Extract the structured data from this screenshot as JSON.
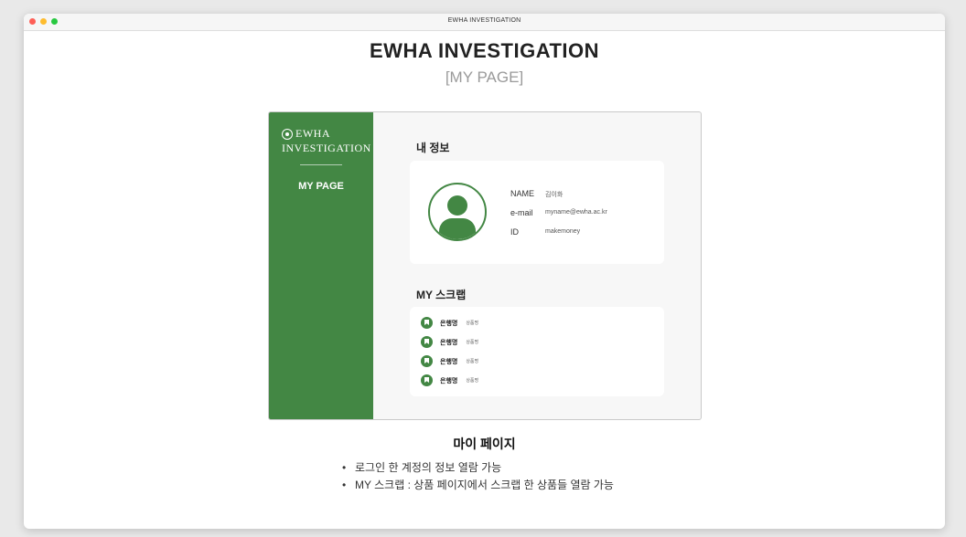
{
  "window": {
    "title": "EWHA INVESTIGATION"
  },
  "header": {
    "title": "EWHA INVESTIGATION",
    "subtitle": "[MY PAGE]"
  },
  "sidebar": {
    "logo_line1": "EWHA",
    "logo_line2": "INVESTIGATION",
    "menu_item": "MY PAGE",
    "color": "#438744"
  },
  "profile": {
    "section_title": "내 정보",
    "fields": [
      {
        "label": "NAME",
        "value": "김이화"
      },
      {
        "label": "e-mail",
        "value": "myname@ewha.ac.kr"
      },
      {
        "label": "ID",
        "value": "makemoney"
      }
    ]
  },
  "scrap": {
    "section_title": "MY 스크랩",
    "items": [
      {
        "bank": "은행명",
        "product": "상품명"
      },
      {
        "bank": "은행명",
        "product": "상품명"
      },
      {
        "bank": "은행명",
        "product": "상품명"
      },
      {
        "bank": "은행명",
        "product": "상품명"
      }
    ]
  },
  "description": {
    "caption": "마이 페이지",
    "bullets": [
      "로그인 한 계정의 정보 열람 가능",
      "MY 스크랩 : 상품 페이지에서 스크랩 한 상품들 열람 가능"
    ]
  }
}
